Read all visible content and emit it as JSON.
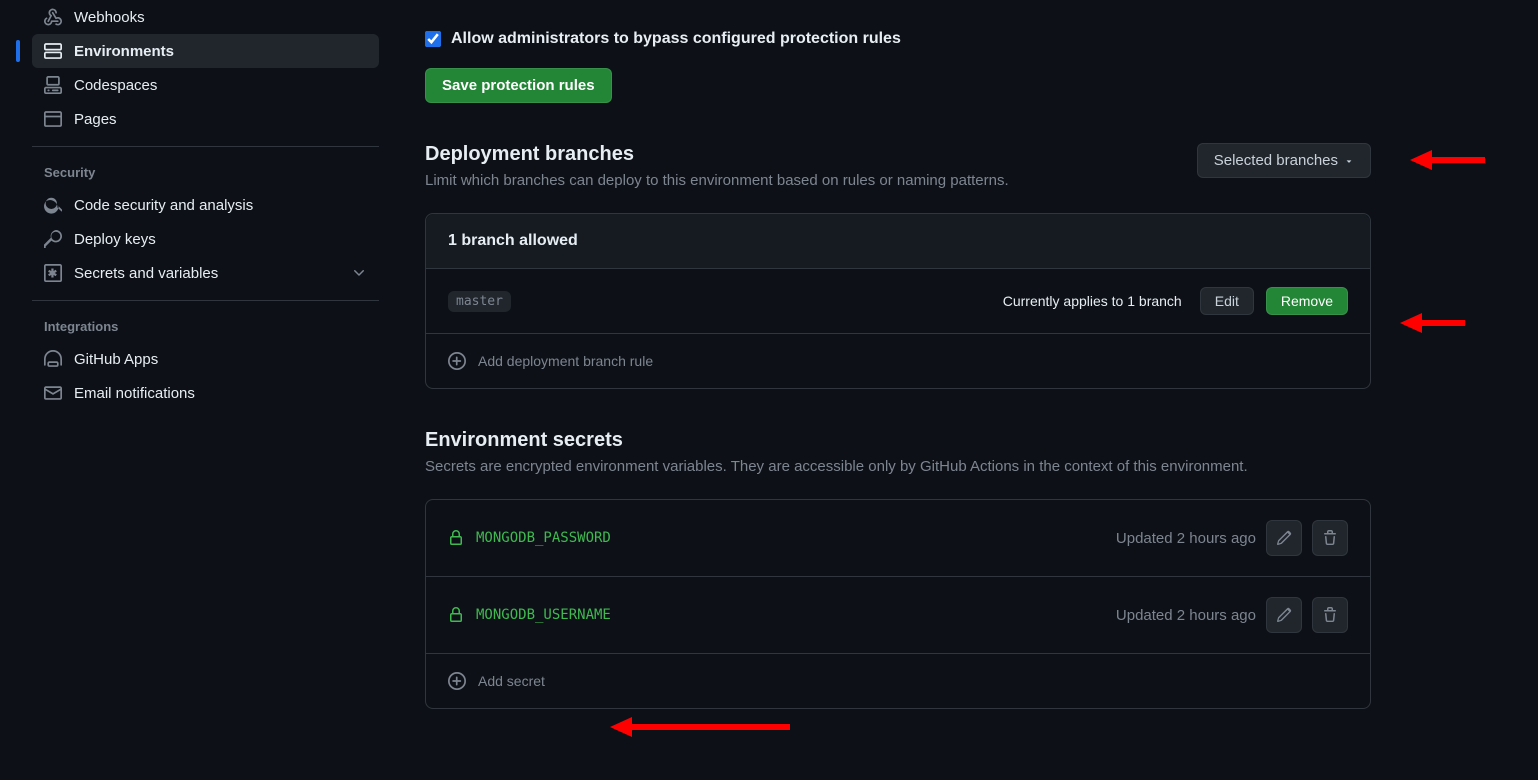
{
  "sidebar": {
    "items": [
      {
        "label": "Webhooks"
      },
      {
        "label": "Environments"
      },
      {
        "label": "Codespaces"
      },
      {
        "label": "Pages"
      }
    ],
    "security_heading": "Security",
    "security_items": [
      {
        "label": "Code security and analysis"
      },
      {
        "label": "Deploy keys"
      },
      {
        "label": "Secrets and variables"
      }
    ],
    "integrations_heading": "Integrations",
    "integrations_items": [
      {
        "label": "GitHub Apps"
      },
      {
        "label": "Email notifications"
      }
    ]
  },
  "protection": {
    "bypass_label": "Allow administrators to bypass configured protection rules",
    "save_button": "Save protection rules"
  },
  "deployment": {
    "title": "Deployment branches",
    "desc": "Limit which branches can deploy to this environment based on rules or naming patterns.",
    "dropdown_label": "Selected branches",
    "box_header": "1 branch allowed",
    "branch_name": "master",
    "branch_status": "Currently applies to 1 branch",
    "edit_label": "Edit",
    "remove_label": "Remove",
    "add_rule_label": "Add deployment branch rule"
  },
  "secrets": {
    "title": "Environment secrets",
    "desc": "Secrets are encrypted environment variables. They are accessible only by GitHub Actions in the context of this environment.",
    "items": [
      {
        "name": "MONGODB_PASSWORD",
        "updated": "Updated 2 hours ago"
      },
      {
        "name": "MONGODB_USERNAME",
        "updated": "Updated 2 hours ago"
      }
    ],
    "add_label": "Add secret"
  }
}
